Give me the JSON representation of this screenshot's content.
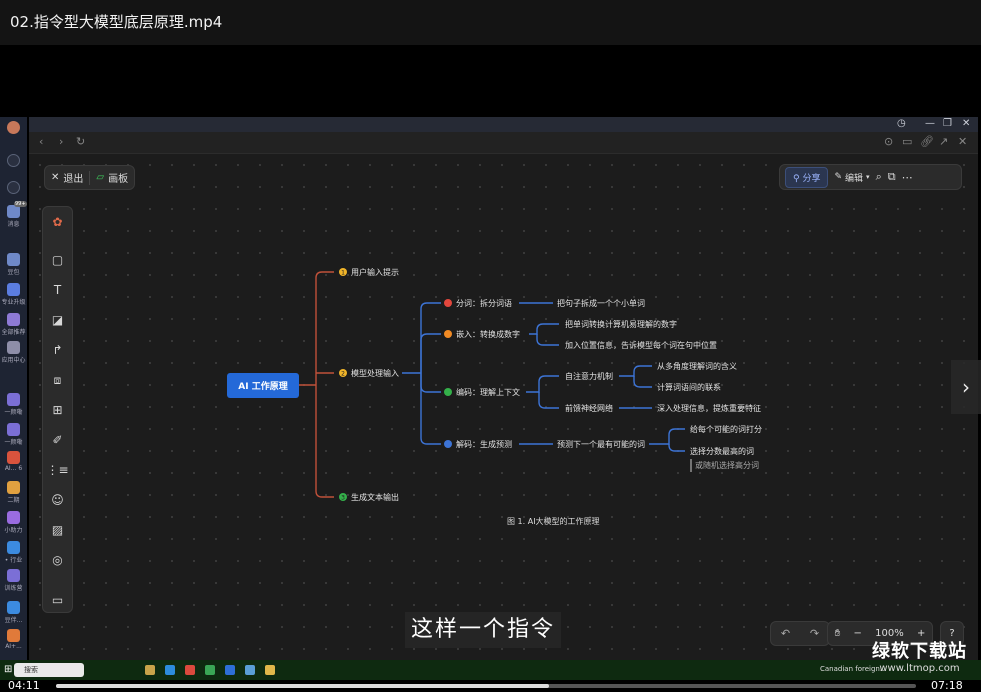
{
  "player": {
    "title": "02.指令型大模型底层原理.mp4",
    "current_time": "04:11",
    "duration": "07:18",
    "progress": 0.573
  },
  "subtitle": "这样一个指令",
  "watermark": {
    "line1": "绿软下载站",
    "line2": "www.ltmop.com"
  },
  "app_sidebar": [
    {
      "icon": "avatar-icon",
      "label": ""
    },
    {
      "icon": "search-icon",
      "label": ""
    },
    {
      "icon": "plus-icon",
      "label": ""
    },
    {
      "icon": "message-icon",
      "label": "消息",
      "badge": "99+"
    },
    {
      "icon": "knowledge-icon",
      "label": "豆包"
    },
    {
      "icon": "diamond-icon",
      "label": "专业升级"
    },
    {
      "icon": "recommend-icon",
      "label": "全部推荐"
    },
    {
      "icon": "app-center-icon",
      "label": "应用中心"
    },
    {
      "icon": "chat-icon",
      "label": "一颜嘞"
    },
    {
      "icon": "chat-icon",
      "label": "一颜嘞"
    },
    {
      "icon": "chat-icon",
      "label": "AI... 6"
    },
    {
      "icon": "chat-icon",
      "label": "二期"
    },
    {
      "icon": "chat-icon",
      "label": "小助力"
    },
    {
      "icon": "chat-icon",
      "label": "• 行业"
    },
    {
      "icon": "chat-icon",
      "label": "训练营"
    },
    {
      "icon": "chat-icon",
      "label": "豆伴..."
    },
    {
      "icon": "chat-icon",
      "label": "AI+..."
    }
  ],
  "toolbar": {
    "exit_label": "退出",
    "board_label": "画板",
    "share_label": "分享",
    "edit_label": "编辑"
  },
  "zoom": {
    "level": "100%"
  },
  "mindmap": {
    "root": "AI 工作原理",
    "caption": "图 1. AI大模型的工作原理",
    "branches": [
      {
        "label": "用户输入提示",
        "num": "1"
      },
      {
        "label": "模型处理输入",
        "num": "2"
      },
      {
        "label": "生成文本输出",
        "num": "3"
      }
    ],
    "steps": [
      {
        "label": "分词：拆分词语"
      },
      {
        "label": "嵌入：转换成数字"
      },
      {
        "label": "编码：理解上下文"
      },
      {
        "label": "解码：生成预测"
      }
    ],
    "details": [
      "把句子拆成一个个小单词",
      "把单词转换计算机易理解的数字",
      "加入位置信息，告诉模型每个词在句中位置",
      "自注意力机制",
      "从多角度理解词的含义",
      "计算词语间的联系",
      "前馈神经网络",
      "深入处理信息，提炼重要特征",
      "预测下一个最有可能的词",
      "给每个可能的词打分",
      "选择分数最高的词",
      "或随机选择高分词"
    ],
    "colors": {
      "root": "#2469d8",
      "branch_line": "#c0513a",
      "step_line": "#3d74d6",
      "dot_red": "#e2473d",
      "dot_orange": "#f08a24",
      "dot_green": "#34b04a",
      "dot_blue": "#3d74d6"
    }
  },
  "taskbar": {
    "search_placeholder": "搜索",
    "weather": "Canadian foreign..."
  }
}
